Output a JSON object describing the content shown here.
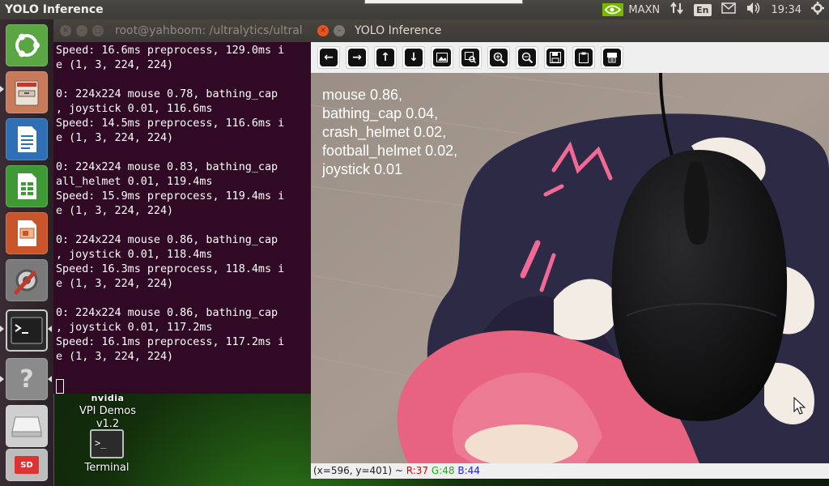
{
  "top_panel": {
    "title": "YOLO Inference",
    "tray": {
      "power_mode": "MAXN",
      "keyboard_layout": "En",
      "clock": "19:34"
    }
  },
  "desktop": {
    "vpi_brand": "nvidia",
    "vpi_label_line1": "VPI Demos",
    "vpi_label_line2": "v1.2",
    "terminal_label": "Terminal"
  },
  "launcher": {
    "items": [
      "ubuntu-dash",
      "files",
      "libreoffice-writer",
      "libreoffice-calc",
      "libreoffice-impress",
      "system-settings",
      "terminal",
      "help",
      "usb-drive",
      "sd-card"
    ],
    "sd_label": "SD"
  },
  "terminal": {
    "title": "root@yahboom: /ultralytics/ultral",
    "lines": [
      "Speed: 16.6ms preprocess, 129.0ms i",
      "e (1, 3, 224, 224)",
      "",
      "0: 224x224 mouse 0.78, bathing_cap",
      ", joystick 0.01, 116.6ms",
      "Speed: 14.5ms preprocess, 116.6ms i",
      "e (1, 3, 224, 224)",
      "",
      "0: 224x224 mouse 0.83, bathing_cap",
      "all_helmet 0.01, 119.4ms",
      "Speed: 15.9ms preprocess, 119.4ms i",
      "e (1, 3, 224, 224)",
      "",
      "0: 224x224 mouse 0.86, bathing_cap",
      ", joystick 0.01, 118.4ms",
      "Speed: 16.3ms preprocess, 118.4ms i",
      "e (1, 3, 224, 224)",
      "",
      "0: 224x224 mouse 0.86, bathing_cap",
      ", joystick 0.01, 117.2ms",
      "Speed: 16.1ms preprocess, 117.2ms i",
      "e (1, 3, 224, 224)"
    ]
  },
  "yolo": {
    "title": "YOLO Inference",
    "toolbar": [
      "arrow-left-icon",
      "arrow-right-icon",
      "arrow-up-icon",
      "arrow-down-icon",
      "image-icon",
      "zoom-fit-icon",
      "zoom-in-icon",
      "zoom-out-icon",
      "save-icon",
      "copy-clipboard-icon",
      "properties-icon"
    ],
    "detections": [
      "mouse 0.86,",
      "bathing_cap 0.04,",
      "crash_helmet 0.02,",
      "football_helmet 0.02,",
      "joystick 0.01"
    ],
    "status": {
      "coords": "(x=596, y=401) ~ ",
      "r": "R:37",
      "g": "G:48",
      "b": "B:44",
      "r_color": "#e00000",
      "g_color": "#22aa22",
      "b_color": "#1a1aff"
    }
  },
  "colors": {
    "terminal_bg": "#300a24",
    "panel_bg": "#3c3b37",
    "close_button": "#e95420"
  }
}
